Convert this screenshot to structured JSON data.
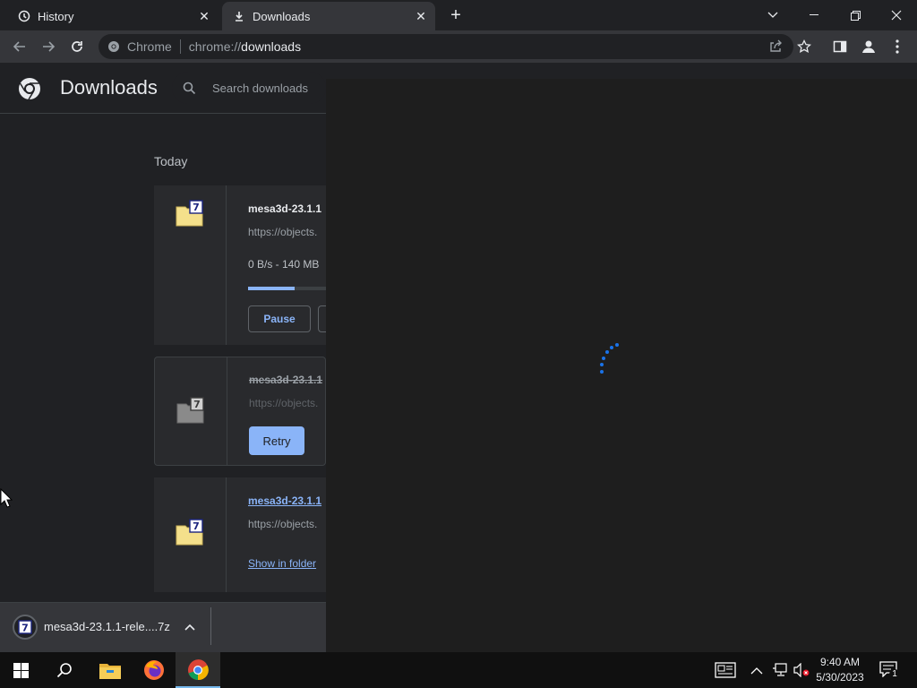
{
  "tabs": [
    {
      "title": "History",
      "icon": "history-icon"
    },
    {
      "title": "Downloads",
      "icon": "download-icon"
    }
  ],
  "address": {
    "origin_label": "Chrome",
    "url_prefix": "chrome://",
    "url_host": "downloads"
  },
  "downloads_page": {
    "title": "Downloads",
    "search_placeholder": "Search downloads",
    "section_today": "Today",
    "items": [
      {
        "name": "mesa3d-23.1.1",
        "url": "https://objects.",
        "status": "0 B/s - 140 MB",
        "progress": 0.6,
        "action": "Pause"
      },
      {
        "name": "mesa3d-23.1.1",
        "url": "https://objects.",
        "action": "Retry"
      },
      {
        "name": "mesa3d-23.1.1",
        "url": "https://objects.",
        "action": "Show in folder"
      }
    ]
  },
  "shelf": {
    "file_label": "mesa3d-23.1.1-rele....7z"
  },
  "taskbar": {
    "time": "9:40 AM",
    "date": "5/30/2023",
    "notification_count": "1"
  },
  "colors": {
    "accent": "#8ab4f8",
    "spinner": "#1a73e8"
  }
}
